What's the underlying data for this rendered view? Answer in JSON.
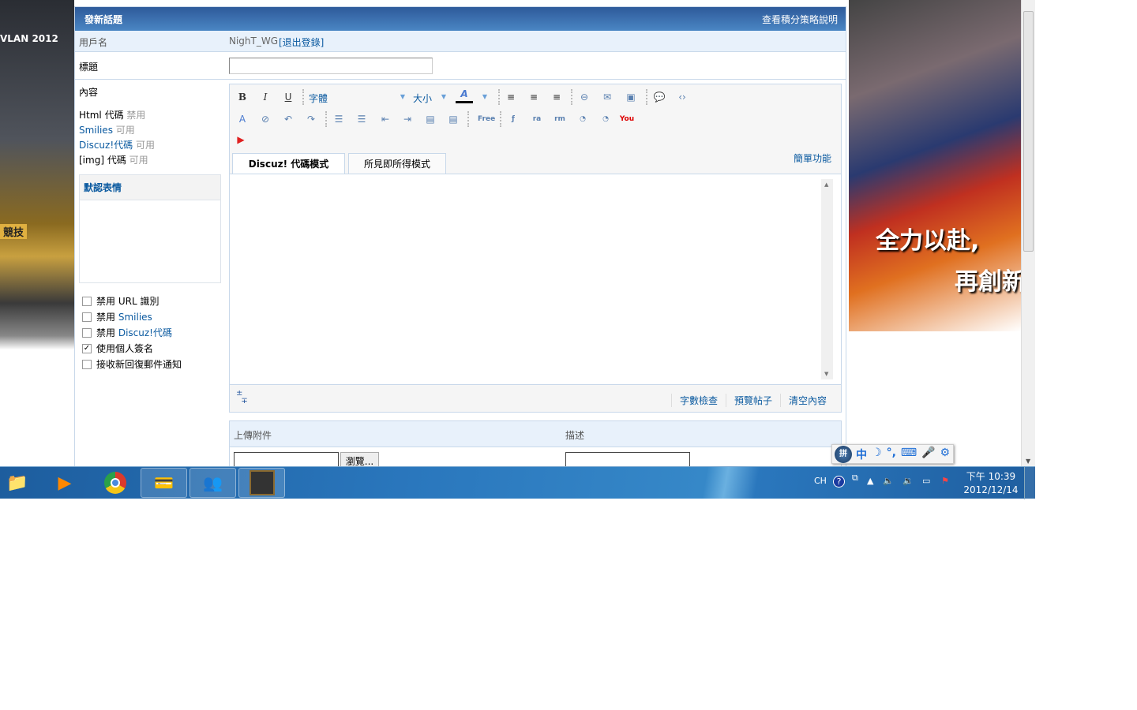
{
  "left_banner": {
    "text": "VLAN 2012",
    "tag": "競技"
  },
  "right_banner": {
    "line1": "全力以赴,",
    "line2": "再創新"
  },
  "form": {
    "title": "發新話題",
    "policy_link": "查看積分策略說明",
    "username_label": "用戶名",
    "username": "NighT_WG",
    "logout_link": "[退出登錄]",
    "subject_label": "標題",
    "subject_value": "",
    "content_label": "內容",
    "status": [
      {
        "name": "Html 代碼",
        "state": "禁用",
        "link": false
      },
      {
        "name": "Smilies",
        "state": "可用",
        "link": true
      },
      {
        "name": "Discuz!代碼",
        "state": "可用",
        "link": true
      },
      {
        "name": "[img] 代碼",
        "state": "可用",
        "link": false
      }
    ],
    "smilies_title": "默認表情",
    "options": [
      {
        "prefix": "禁用",
        "label": "URL 識別",
        "link": false,
        "checked": false
      },
      {
        "prefix": "禁用",
        "label": "Smilies",
        "link": true,
        "checked": false
      },
      {
        "prefix": "禁用",
        "label": "Discuz!代碼",
        "link": true,
        "checked": false
      },
      {
        "prefix": "",
        "label": "使用個人簽名",
        "link": false,
        "checked": true
      },
      {
        "prefix": "",
        "label": "接收新回復郵件通知",
        "link": false,
        "checked": false
      }
    ]
  },
  "editor": {
    "font_label": "字體",
    "size_label": "大小",
    "toolbar_row1": [
      {
        "icon": "bold-icon",
        "glyph": "B"
      },
      {
        "icon": "italic-icon",
        "glyph": "I"
      },
      {
        "icon": "underline-icon",
        "glyph": "U"
      }
    ],
    "toolbar_row1b": [
      {
        "icon": "align-left-icon",
        "glyph": "≡"
      },
      {
        "icon": "align-center-icon",
        "glyph": "≡"
      },
      {
        "icon": "align-right-icon",
        "glyph": "≡"
      },
      {
        "icon": "link-icon",
        "glyph": "⊖"
      },
      {
        "icon": "email-icon",
        "glyph": "✉"
      },
      {
        "icon": "image-icon",
        "glyph": "▣"
      },
      {
        "icon": "quote-icon",
        "glyph": "💬"
      },
      {
        "icon": "code-icon",
        "glyph": "‹›"
      }
    ],
    "toolbar_row2": [
      {
        "icon": "remove-format-icon",
        "glyph": "A"
      },
      {
        "icon": "unlink-icon",
        "glyph": "⊘"
      },
      {
        "icon": "undo-icon",
        "glyph": "↶"
      },
      {
        "icon": "redo-icon",
        "glyph": "↷"
      },
      {
        "icon": "ordered-list-icon",
        "glyph": "☰"
      },
      {
        "icon": "unordered-list-icon",
        "glyph": "☰"
      },
      {
        "icon": "outdent-icon",
        "glyph": "⇤"
      },
      {
        "icon": "indent-icon",
        "glyph": "⇥"
      },
      {
        "icon": "float-left-icon",
        "glyph": "▤"
      },
      {
        "icon": "float-right-icon",
        "glyph": "▤"
      },
      {
        "icon": "free-icon",
        "glyph": "Free"
      },
      {
        "icon": "flash-icon",
        "glyph": "ƒ"
      },
      {
        "icon": "real-audio-icon",
        "glyph": "ra"
      },
      {
        "icon": "real-media-icon",
        "glyph": "rm"
      },
      {
        "icon": "wma-icon",
        "glyph": "◔"
      },
      {
        "icon": "wmv-icon",
        "glyph": "◔"
      },
      {
        "icon": "youtube-icon",
        "glyph": "You"
      }
    ],
    "tabs": [
      "Discuz! 代碼模式",
      "所見即所得模式"
    ],
    "simple_link": "簡單功能",
    "footer_buttons": [
      "字數檢查",
      "預覽帖子",
      "清空內容"
    ]
  },
  "attachment": {
    "upload_label": "上傳附件",
    "desc_label": "描述",
    "browse_label": "瀏覽..."
  },
  "ime": {
    "items": [
      "中",
      "☽",
      "°,",
      "⌨",
      "🎤",
      "⚙"
    ]
  },
  "taskbar": {
    "lang": "CH",
    "time": "下午 10:39",
    "date": "2012/12/14"
  }
}
